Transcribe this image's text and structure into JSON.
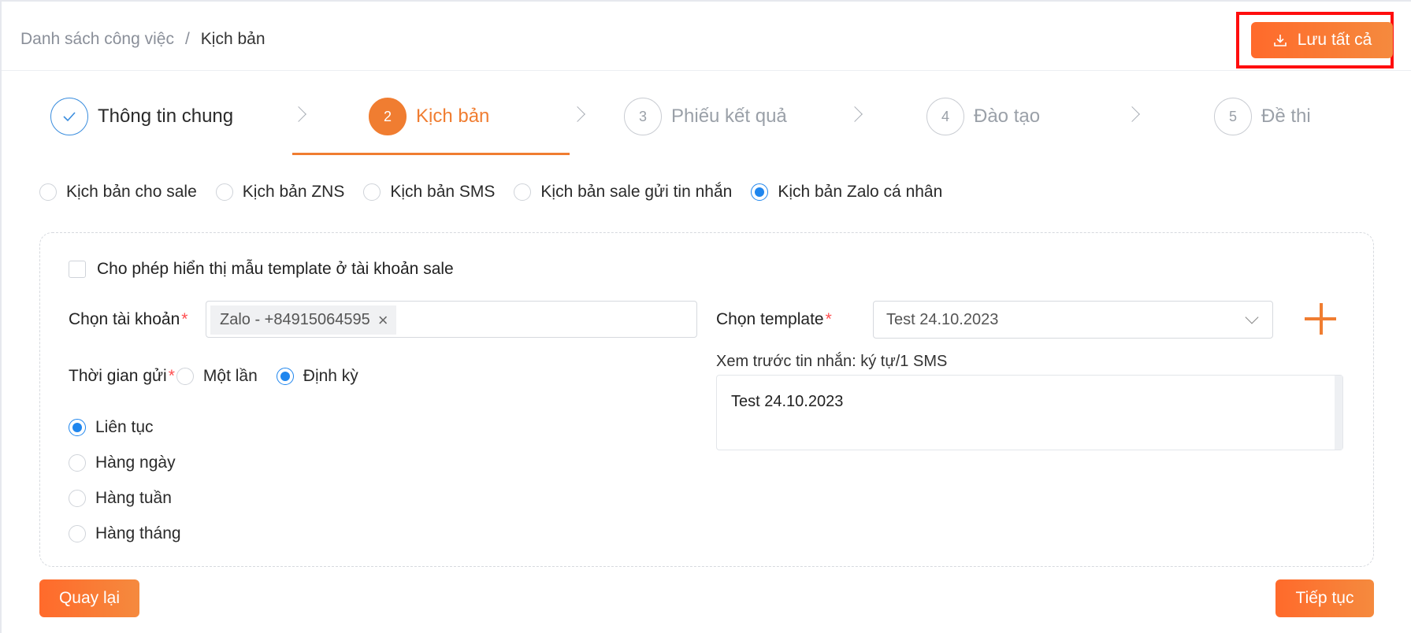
{
  "breadcrumb": {
    "parent": "Danh sách công việc",
    "separator": "/",
    "current": "Kịch bản"
  },
  "actions": {
    "save_all": "Lưu tất cả"
  },
  "steps": [
    {
      "number": "",
      "label": "Thông tin chung",
      "state": "done"
    },
    {
      "number": "2",
      "label": "Kịch bản",
      "state": "active"
    },
    {
      "number": "3",
      "label": "Phiếu kết quả",
      "state": "todo"
    },
    {
      "number": "4",
      "label": "Đào tạo",
      "state": "todo"
    },
    {
      "number": "5",
      "label": "Đề thi",
      "state": "todo"
    }
  ],
  "script_types": {
    "selected": "Kịch bản Zalo cá nhân",
    "options": [
      "Kịch bản cho sale",
      "Kịch bản ZNS",
      "Kịch bản SMS",
      "Kịch bản sale gửi tin nhắn",
      "Kịch bản Zalo cá nhân"
    ]
  },
  "form": {
    "show_template_checkbox": {
      "label": "Cho phép hiển thị mẫu template ở tài khoản sale",
      "checked": false
    },
    "account": {
      "label": "Chọn tài khoản",
      "required_mark": "*",
      "selected_tag": "Zalo - +84915064595"
    },
    "template": {
      "label": "Chọn template",
      "required_mark": "*",
      "value": "Test 24.10.2023"
    },
    "preview": {
      "label": "Xem trước tin nhắn: ký tự/1 SMS",
      "content": "Test 24.10.2023"
    },
    "send_time": {
      "label": "Thời gian gửi",
      "required_mark": "*",
      "options": [
        "Một lần",
        "Định kỳ"
      ],
      "selected": "Định kỳ"
    },
    "frequency": {
      "options": [
        "Liên tục",
        "Hàng ngày",
        "Hàng tuần",
        "Hàng tháng"
      ],
      "selected": "Liên tục"
    }
  },
  "footer": {
    "back": "Quay lại",
    "next": "Tiếp tục"
  },
  "colors": {
    "accent": "#f07d31",
    "primary_blue": "#1f86ee",
    "highlight_border": "#ff0d0d"
  }
}
